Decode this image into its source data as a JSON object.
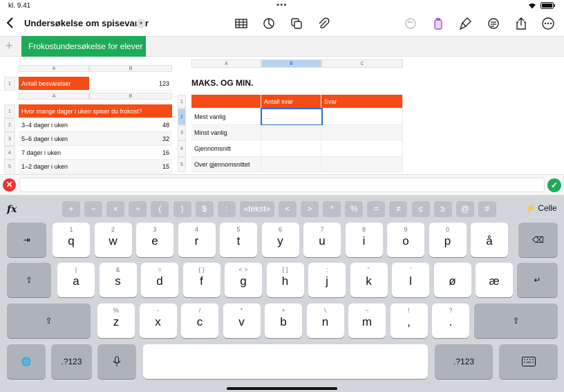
{
  "status": {
    "time": "kl. 9.41"
  },
  "toolbar": {
    "title": "Undersøkelse om spisevaner"
  },
  "sheets": {
    "active": "Frokostundersøkelse for elever"
  },
  "table1": {
    "col_a": "A",
    "col_b": "B",
    "row": "1",
    "label": "Antall besvarelser",
    "value": "123"
  },
  "table2": {
    "col_a": "A",
    "col_b": "B",
    "header": "Hvor mange dager i uken spiser du frokost?",
    "rows": [
      {
        "num": "1",
        "label": "",
        "value": ""
      },
      {
        "num": "2",
        "label": "3–4 dager i uken",
        "value": "48"
      },
      {
        "num": "3",
        "label": "5–6 dager i uken",
        "value": "32"
      },
      {
        "num": "4",
        "label": "7 dager i uken",
        "value": "16"
      },
      {
        "num": "5",
        "label": "1–2 dager i uken",
        "value": "15"
      }
    ]
  },
  "table3": {
    "title": "MAKS. OG MIN.",
    "cols": [
      "A",
      "B",
      "C"
    ],
    "headers": [
      "",
      "Antall svar",
      "Svar"
    ],
    "rows": [
      {
        "num": "1",
        "label": ""
      },
      {
        "num": "2",
        "label": "Mest vanlig",
        "b": "…"
      },
      {
        "num": "3",
        "label": "Minst vanlig"
      },
      {
        "num": "4",
        "label": "Gjennomsnitt"
      },
      {
        "num": "5",
        "label": "Over gjennomsnittet"
      }
    ]
  },
  "formula": {
    "fx": "fx",
    "celle": "Celle"
  },
  "operators": [
    "+",
    "−",
    "×",
    "÷",
    "(",
    ")",
    "$",
    ":",
    "«tekst»",
    "<",
    ">",
    "^",
    "%",
    "=",
    "≠",
    "≤",
    "≥",
    "@",
    "#"
  ],
  "keys": {
    "row1": [
      {
        "hint": "1",
        "main": "q"
      },
      {
        "hint": "2",
        "main": "w"
      },
      {
        "hint": "3",
        "main": "e"
      },
      {
        "hint": "4",
        "main": "r"
      },
      {
        "hint": "5",
        "main": "t"
      },
      {
        "hint": "6",
        "main": "y"
      },
      {
        "hint": "7",
        "main": "u"
      },
      {
        "hint": "8",
        "main": "i"
      },
      {
        "hint": "9",
        "main": "o"
      },
      {
        "hint": "0",
        "main": "p"
      },
      {
        "hint": "",
        "main": "å"
      }
    ],
    "row2": [
      {
        "hint": "|",
        "main": "a"
      },
      {
        "hint": "&",
        "main": "s"
      },
      {
        "hint": "=",
        "main": "d"
      },
      {
        "hint": "{ }",
        "main": "f"
      },
      {
        "hint": "< >",
        "main": "g"
      },
      {
        "hint": "[ ]",
        "main": "h"
      },
      {
        "hint": ";",
        "main": "j"
      },
      {
        "hint": "\"",
        "main": "k"
      },
      {
        "hint": "'",
        "main": "l"
      },
      {
        "hint": "",
        "main": "ø"
      },
      {
        "hint": "",
        "main": "æ"
      }
    ],
    "row3": [
      {
        "hint": "%",
        "main": "z"
      },
      {
        "hint": "-",
        "main": "x"
      },
      {
        "hint": "/",
        "main": "c"
      },
      {
        "hint": "*",
        "main": "v"
      },
      {
        "hint": "+",
        "main": "b"
      },
      {
        "hint": "\\",
        "main": "n"
      },
      {
        "hint": "~",
        "main": "m"
      },
      {
        "hint": "!",
        "main": ","
      },
      {
        "hint": "?",
        "main": "."
      }
    ],
    "num_left": ".?123",
    "num_right": ".?123"
  }
}
